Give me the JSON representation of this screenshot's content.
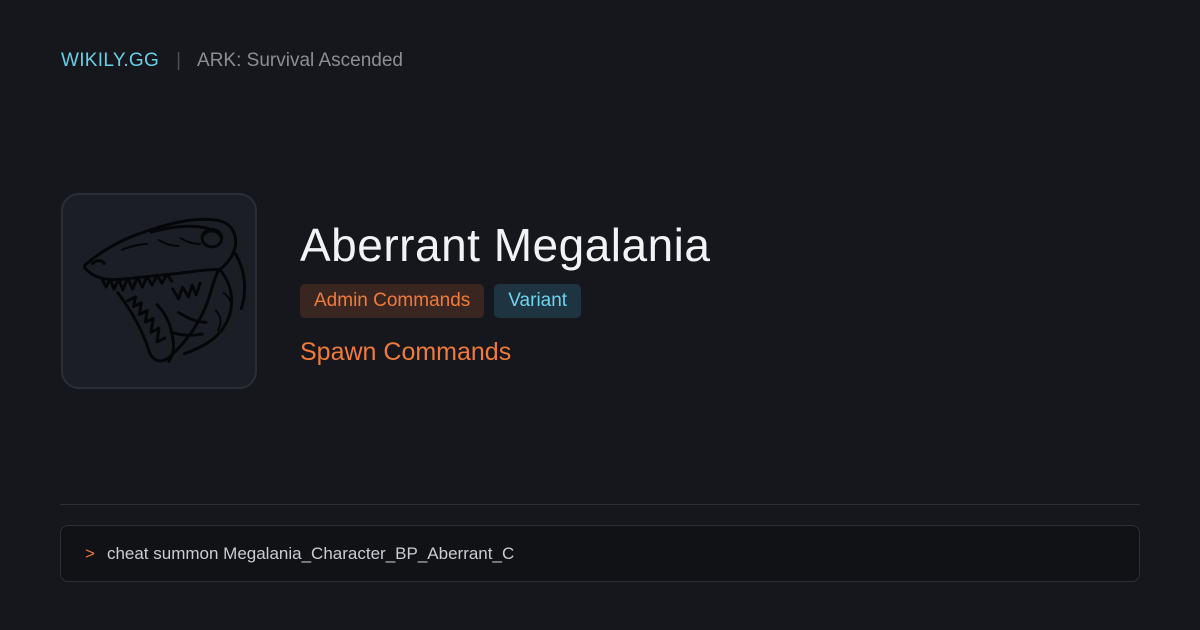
{
  "header": {
    "brand": "WIKILY.GG",
    "separator": "|",
    "game": "ARK: Survival Ascended"
  },
  "creature": {
    "icon": "megalania-head-icon",
    "name": "Aberrant Megalania",
    "tags": [
      {
        "label": "Admin Commands",
        "color": "#f07a3a"
      },
      {
        "label": "Variant",
        "color": "#6fd3ee"
      }
    ],
    "subtitle": "Spawn Commands"
  },
  "command": {
    "prompt": ">",
    "text": "cheat summon Megalania_Character_BP_Aberrant_C"
  },
  "colors": {
    "background": "#15171c",
    "brand": "#67cfe8",
    "accent": "#f07a3a"
  }
}
